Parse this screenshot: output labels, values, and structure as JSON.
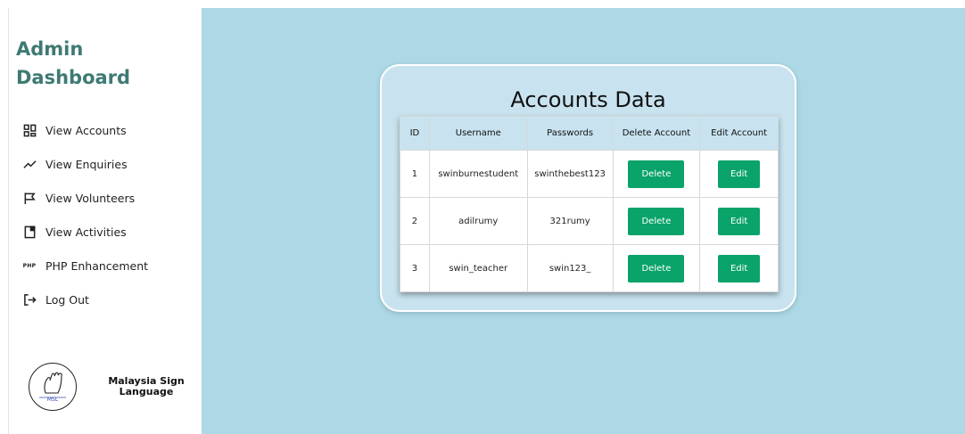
{
  "sidebar": {
    "title_line1": "Admin",
    "title_line2": "Dashboard",
    "items": [
      {
        "label": "View Accounts",
        "icon": "grid-icon"
      },
      {
        "label": "View Enquiries",
        "icon": "trend-line-icon"
      },
      {
        "label": "View Volunteers",
        "icon": "flag-icon"
      },
      {
        "label": "View Activities",
        "icon": "document-icon"
      },
      {
        "label": "PHP Enhancement",
        "icon": "php-icon"
      },
      {
        "label": "Log Out",
        "icon": "logout-icon"
      }
    ],
    "php_icon_text": "PHP",
    "logo_text_line1": "Malaysia Sign",
    "logo_text_line2": "Language",
    "logo_badge_text": "MSL"
  },
  "main": {
    "card_title": "Accounts Data",
    "table": {
      "headers": [
        "ID",
        "Username",
        "Passwords",
        "Delete Account",
        "Edit Account"
      ],
      "rows": [
        {
          "id": "1",
          "username": "swinburnestudent",
          "password": "swinthebest123",
          "delete_label": "Delete",
          "edit_label": "Edit"
        },
        {
          "id": "2",
          "username": "adilrumy",
          "password": "321rumy",
          "delete_label": "Delete",
          "edit_label": "Edit"
        },
        {
          "id": "3",
          "username": "swin_teacher",
          "password": "swin123_",
          "delete_label": "Delete",
          "edit_label": "Edit"
        }
      ]
    }
  },
  "colors": {
    "brand": "#3e7a73",
    "background": "#add8e6",
    "card": "#c8e3ef",
    "button": "#0aa36a"
  }
}
